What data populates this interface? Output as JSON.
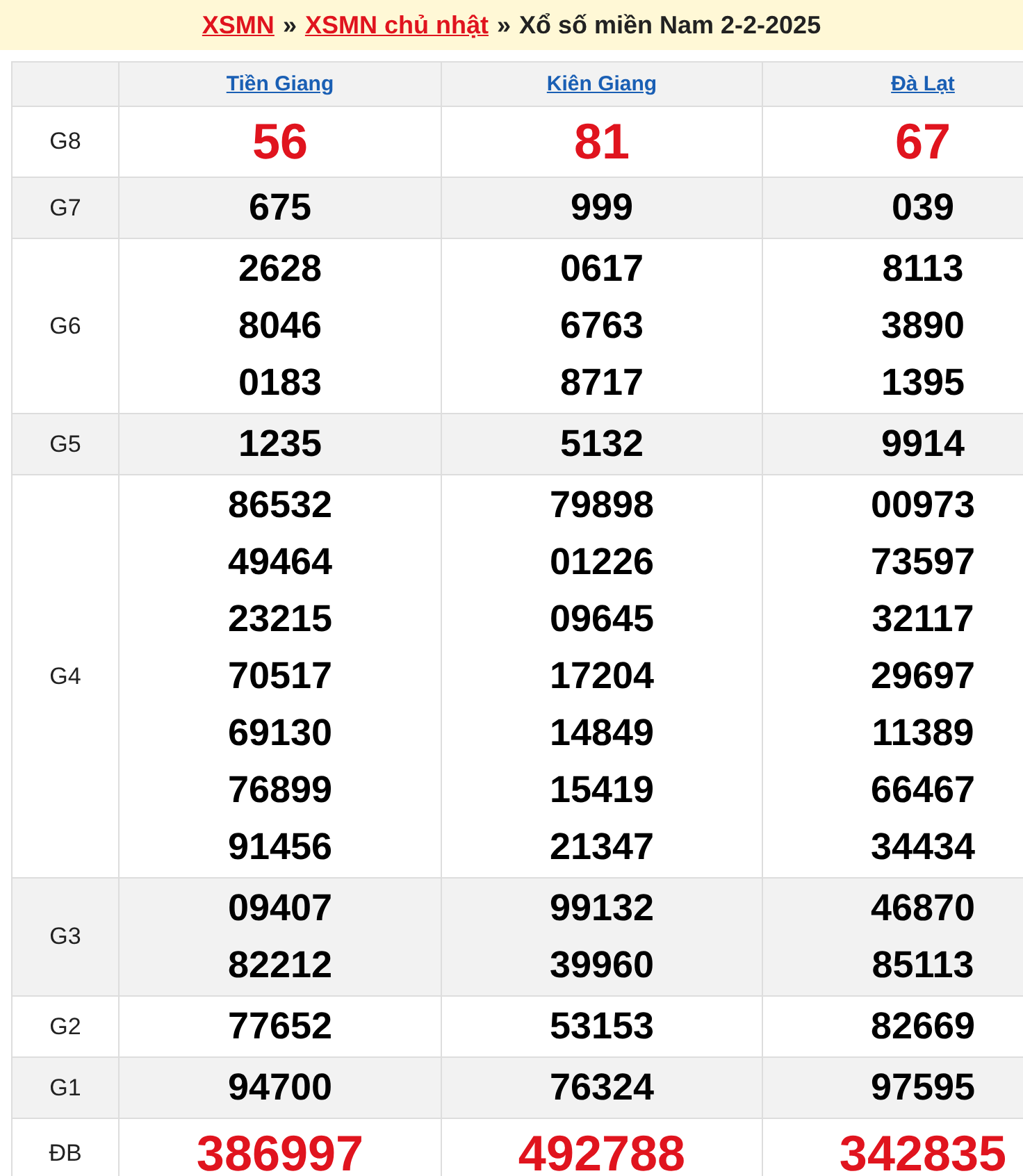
{
  "breadcrumb": {
    "links": [
      "XSMN",
      "XSMN chủ nhật"
    ],
    "separator": "»",
    "title": "Xổ số miền Nam 2-2-2025"
  },
  "table": {
    "columns": [
      "Tiền Giang",
      "Kiên Giang",
      "Đà Lạt"
    ],
    "rows": [
      {
        "label": "G8",
        "kind": "highlight",
        "values": [
          [
            "56"
          ],
          [
            "81"
          ],
          [
            "67"
          ]
        ]
      },
      {
        "label": "G7",
        "kind": "normal",
        "values": [
          [
            "675"
          ],
          [
            "999"
          ],
          [
            "039"
          ]
        ]
      },
      {
        "label": "G6",
        "kind": "normal",
        "values": [
          [
            "2628",
            "8046",
            "0183"
          ],
          [
            "0617",
            "6763",
            "8717"
          ],
          [
            "8113",
            "3890",
            "1395"
          ]
        ]
      },
      {
        "label": "G5",
        "kind": "normal",
        "values": [
          [
            "1235"
          ],
          [
            "5132"
          ],
          [
            "9914"
          ]
        ]
      },
      {
        "label": "G4",
        "kind": "normal",
        "values": [
          [
            "86532",
            "49464",
            "23215",
            "70517",
            "69130",
            "76899",
            "91456"
          ],
          [
            "79898",
            "01226",
            "09645",
            "17204",
            "14849",
            "15419",
            "21347"
          ],
          [
            "00973",
            "73597",
            "32117",
            "29697",
            "11389",
            "66467",
            "34434"
          ]
        ]
      },
      {
        "label": "G3",
        "kind": "normal",
        "values": [
          [
            "09407",
            "82212"
          ],
          [
            "99132",
            "39960"
          ],
          [
            "46870",
            "85113"
          ]
        ]
      },
      {
        "label": "G2",
        "kind": "normal",
        "values": [
          [
            "77652"
          ],
          [
            "53153"
          ],
          [
            "82669"
          ]
        ]
      },
      {
        "label": "G1",
        "kind": "normal",
        "values": [
          [
            "94700"
          ],
          [
            "76324"
          ],
          [
            "97595"
          ]
        ]
      },
      {
        "label": "ĐB",
        "kind": "highlight",
        "values": [
          [
            "386997"
          ],
          [
            "492788"
          ],
          [
            "342835"
          ]
        ]
      }
    ]
  }
}
